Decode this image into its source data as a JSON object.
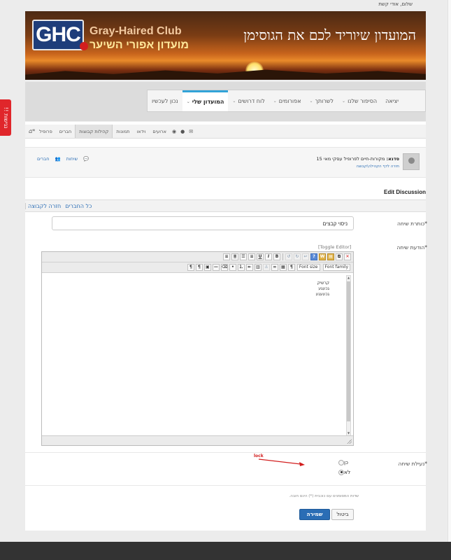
{
  "header": {
    "greeting": "שלום, אודי קשת"
  },
  "banner": {
    "logo_text": "GHC",
    "club_name_en": "Gray-Haired Club",
    "club_name_he": "מועדון אפורי השיער",
    "slogan": "המועדון שיוריד לכם את הגוסימן"
  },
  "side_tab": {
    "label": "!! נגישות"
  },
  "main_nav": {
    "items": [
      {
        "label": "נכון לעכשיו",
        "has_dropdown": false
      },
      {
        "label": "המועדון שלי",
        "has_dropdown": true,
        "active": true
      },
      {
        "label": "לוח דרושים",
        "has_dropdown": true
      },
      {
        "label": "אפורומים",
        "has_dropdown": true
      },
      {
        "label": "לשרותך",
        "has_dropdown": true
      },
      {
        "label": "הסיפור שלנו",
        "has_dropdown": true
      },
      {
        "label": "יציאה",
        "has_dropdown": false
      }
    ]
  },
  "sub_nav": {
    "items": [
      {
        "label": "פרופיל"
      },
      {
        "label": "חברים"
      },
      {
        "label": "קהילות קבוצות",
        "active": true
      },
      {
        "label": "תמונות"
      },
      {
        "label": "וידאו"
      },
      {
        "label": "ארועים"
      }
    ],
    "icons": [
      "home-icon",
      "globe-icon",
      "user-icon",
      "envelope-icon",
      "logout-icon"
    ]
  },
  "group": {
    "prefix": "סדנא:",
    "title": "מקורות-חיים לפרופיל עסקי מאי 15",
    "back_link": "חזרה לדף הקהילה\\קבוצה",
    "actions": {
      "discussions": "שיחות",
      "members": "חברים"
    }
  },
  "page": {
    "heading": "Edit Discussion"
  },
  "tabs": {
    "back_to_group": "חזרה לקבוצה",
    "all_members": "כל החברים"
  },
  "form": {
    "title_label": "*כותרת שיחה",
    "title_value": "ניסוי קבצים",
    "message_label": "*הודעת שיחה",
    "toggle_editor": "[Toggle Editor]",
    "font_family": "Font family",
    "font_size": "Font size",
    "editor_lines": [
      "קרשיק",
      "גכעגע",
      "גכעעגע"
    ],
    "lock_label": "*נעילת שיחה",
    "lock_options": [
      {
        "label": "כן",
        "checked": false
      },
      {
        "label": "לא",
        "checked": true
      }
    ],
    "required_hint": "שדות המסומנים עם כוכבית (*) הינם חובה.",
    "save_label": "שמירה",
    "cancel_label": "ביטול"
  },
  "annotation": {
    "label": "lock",
    "color": "#d21e1e"
  },
  "colors": {
    "accent": "#31a3d8",
    "link": "#2a6db5",
    "primary_button": "#2a6db5",
    "side_tab": "#e0262b",
    "footer": "#333333"
  }
}
